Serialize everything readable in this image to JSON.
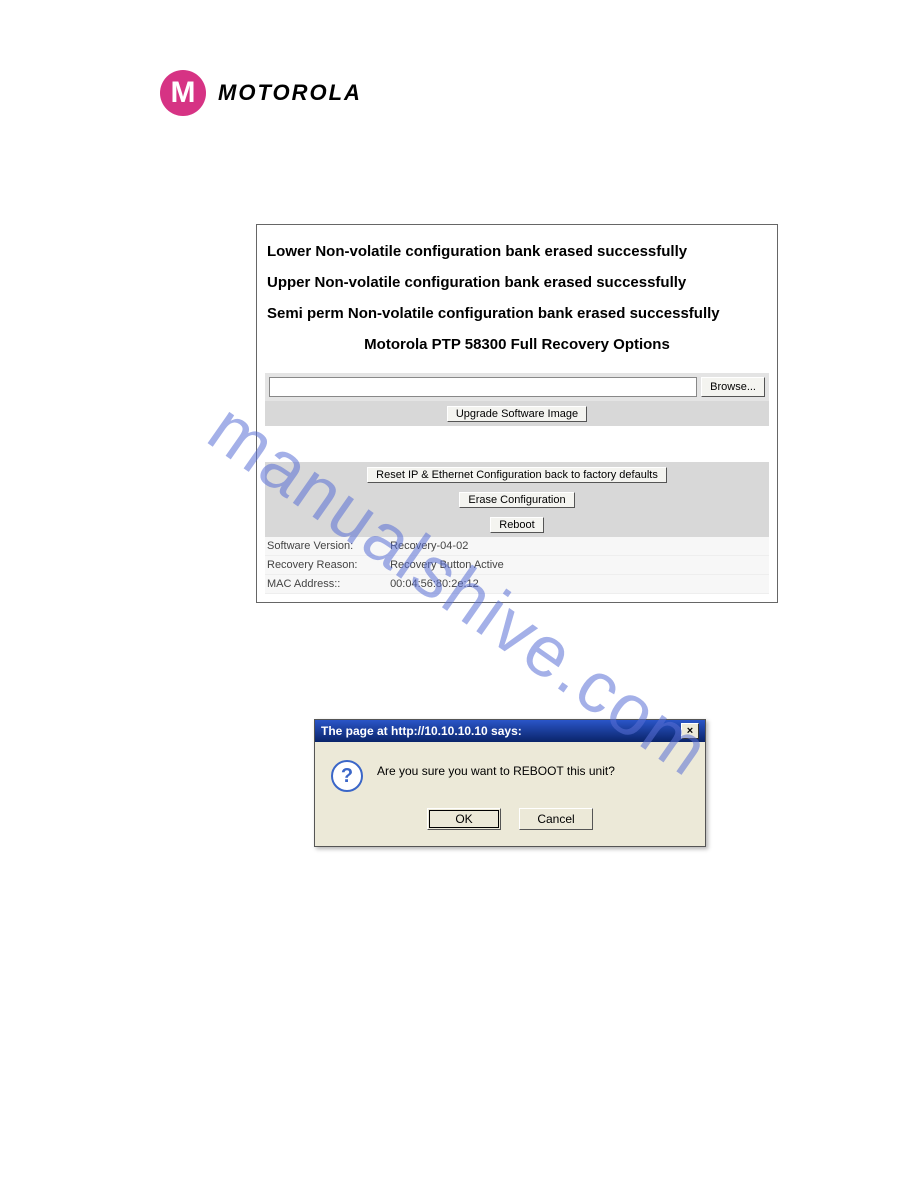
{
  "brand": {
    "mark": "M",
    "name": "MOTOROLA"
  },
  "watermark": "manualshive.com",
  "panel": {
    "msg1": "Lower Non-volatile configuration bank erased successfully",
    "msg2": "Upper Non-volatile configuration bank erased successfully",
    "msg3": "Semi perm Non-volatile configuration bank erased successfully",
    "title": "Motorola PTP 58300 Full Recovery Options",
    "file_value": "",
    "browse": "Browse...",
    "upgrade": "Upgrade Software Image",
    "reset_ip": "Reset IP & Ethernet Configuration back to factory defaults",
    "erase": "Erase Configuration",
    "reboot": "Reboot",
    "sw_label": "Software Version:",
    "sw_value": "Recovery-04-02",
    "reason_label": "Recovery Reason:",
    "reason_value": "Recovery Button Active",
    "mac_label": "MAC Address::",
    "mac_value": "00:04:56:80:2e:12"
  },
  "dialog": {
    "title": "The page at http://10.10.10.10 says:",
    "message": "Are you sure you want to REBOOT this unit?",
    "ok": "OK",
    "cancel": "Cancel",
    "close": "×",
    "question": "?"
  }
}
